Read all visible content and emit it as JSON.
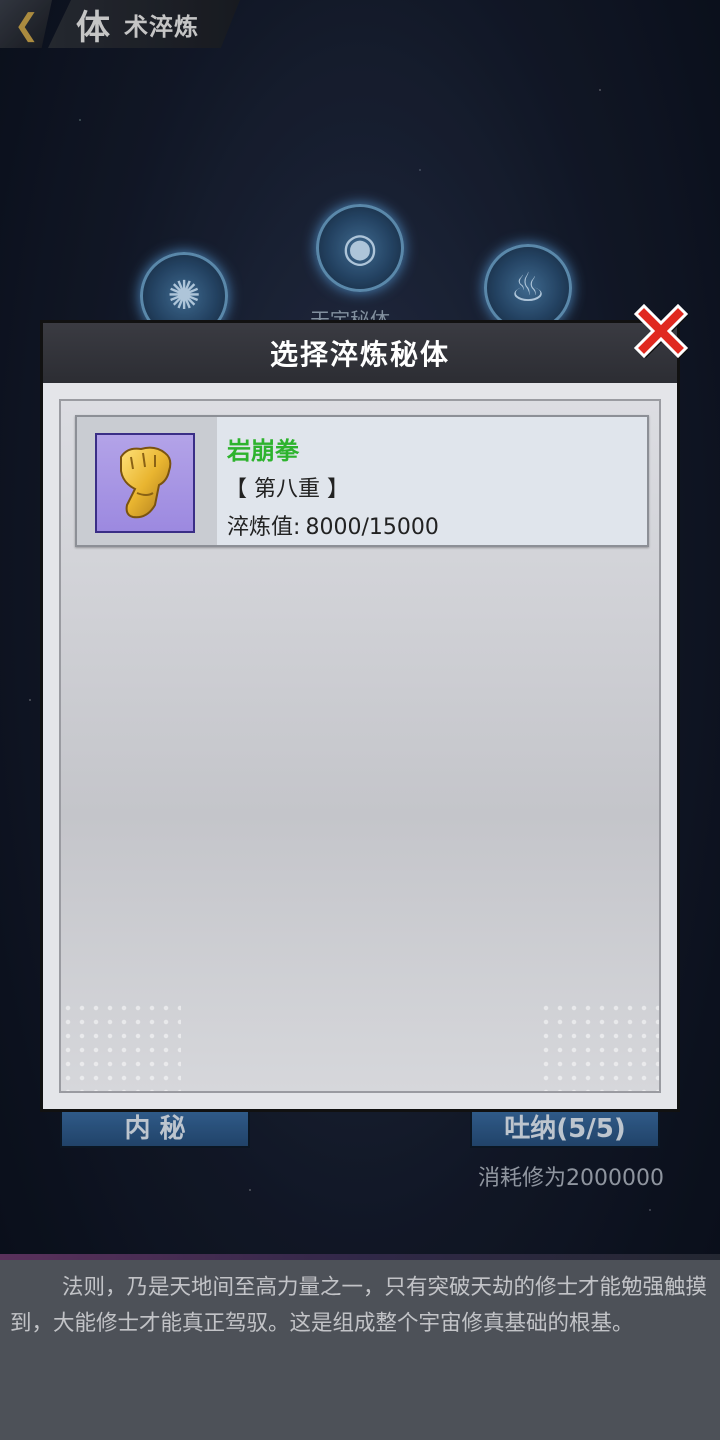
{
  "header": {
    "title_big": "体",
    "title_small": "术淬炼",
    "back_icon": "chevron-left-icon"
  },
  "background": {
    "orb_label": "天宇秘体",
    "left_button_label": "内 秘",
    "right_button_label": "吐纳(5/5)",
    "cost_text": "消耗修为2000000"
  },
  "dialog": {
    "title": "选择淬炼秘体",
    "close_icon": "close-x-icon",
    "items": [
      {
        "name": "岩崩拳",
        "level": "【 第八重 】",
        "value_label": "淬炼值:",
        "value": "8000/15000",
        "icon": "golden-fist-icon",
        "name_color": "#2db32d"
      }
    ]
  },
  "description": {
    "text": "法则，乃是天地间至高力量之一，只有突破天劫的修士才能勉强触摸到，大能修士才能真正驾驭。这是组成整个宇宙修真基础的根基。"
  }
}
